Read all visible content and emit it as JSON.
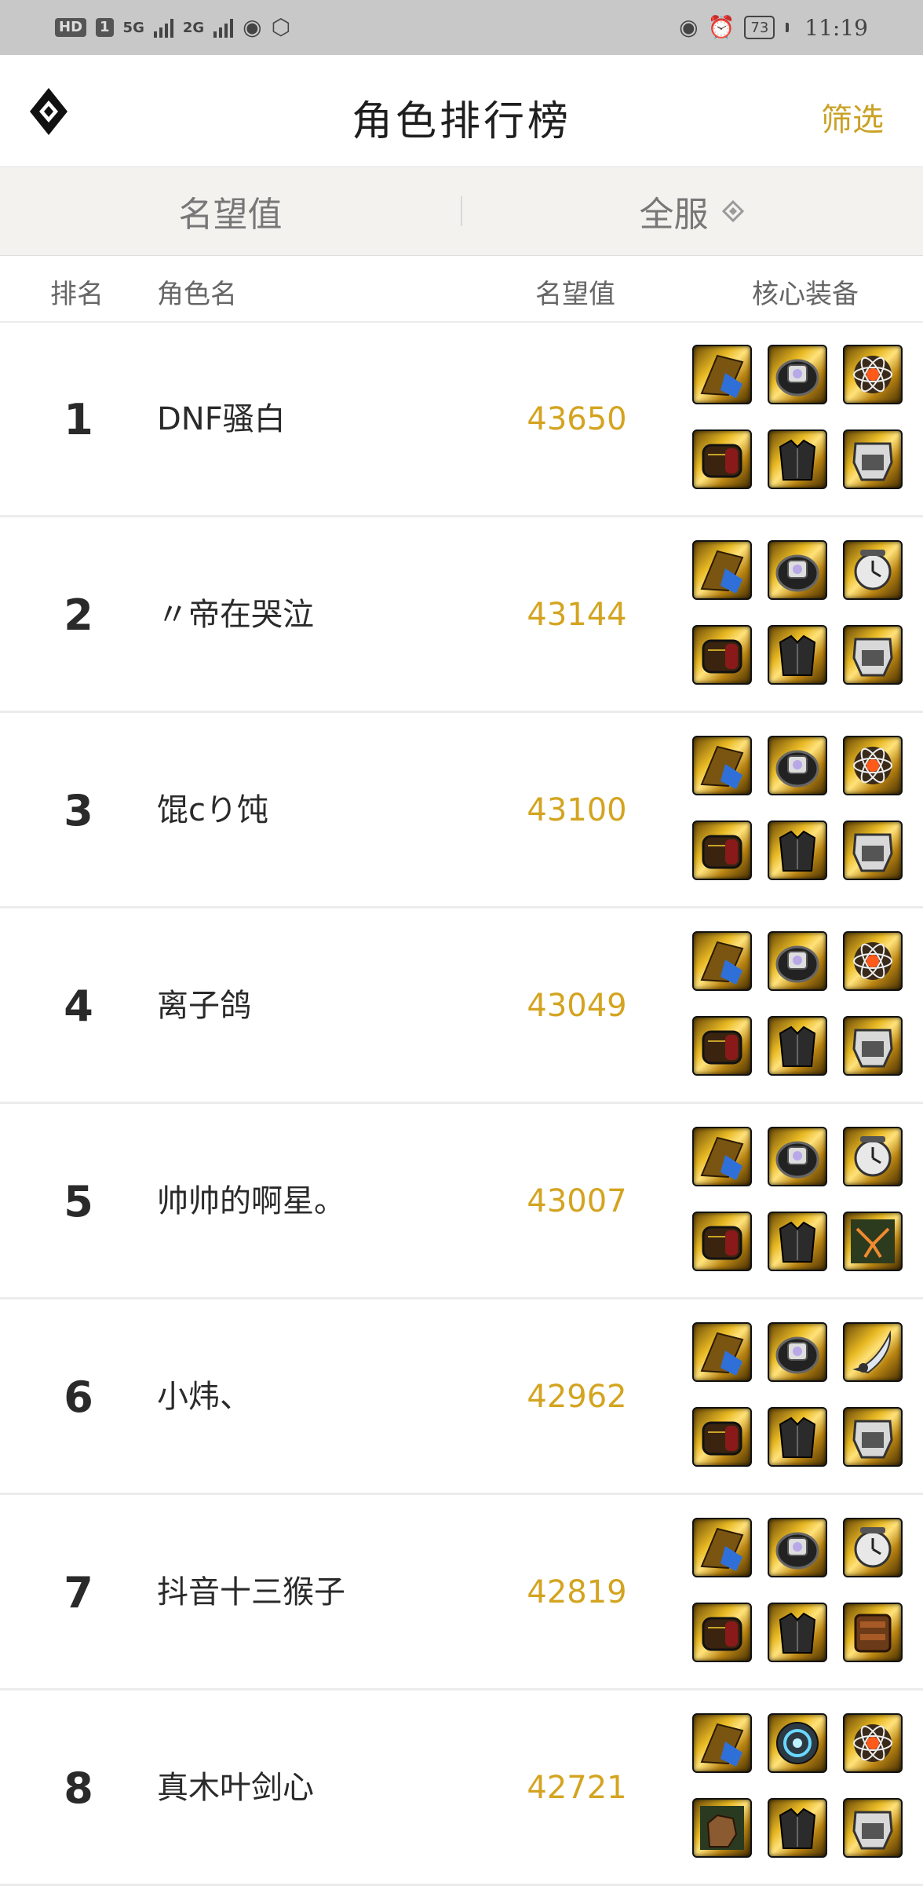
{
  "status_bar": {
    "hd": "HD",
    "sim": "1",
    "net1": "5G",
    "net2": "2G",
    "battery": "73",
    "time": "11:19",
    "icons": [
      "chat-bubble-icon",
      "hand-shield-icon",
      "eye-icon",
      "alarm-icon"
    ]
  },
  "header": {
    "title": "角色排行榜",
    "filter_label": "筛选",
    "logo_icon": "diamond-logo-icon"
  },
  "selector": {
    "left_label": "名望值",
    "right_label": "全服"
  },
  "columns": {
    "rank": "排名",
    "name": "角色名",
    "score": "名望值",
    "equip": "核心装备"
  },
  "colors": {
    "accent_gold": "#c9a227",
    "score_gold": "#d4a420"
  },
  "rows": [
    {
      "rank": "1",
      "name": "DNF骚白",
      "score": "43650",
      "equipment": [
        "shoulder",
        "bracelet",
        "atom-orb",
        "box",
        "dark-armor",
        "gauntlet-armor"
      ]
    },
    {
      "rank": "2",
      "name": "〃帝在哭泣",
      "score": "43144",
      "equipment": [
        "shoulder",
        "bracelet",
        "clock",
        "box",
        "dark-armor",
        "gauntlet-armor"
      ]
    },
    {
      "rank": "3",
      "name": "馄cり饨",
      "score": "43100",
      "equipment": [
        "shoulder",
        "bracelet",
        "atom-orb",
        "box",
        "dark-armor",
        "gauntlet-armor"
      ]
    },
    {
      "rank": "4",
      "name": "离子鸽",
      "score": "43049",
      "equipment": [
        "shoulder",
        "bracelet",
        "atom-orb",
        "box",
        "dark-armor",
        "gauntlet-armor"
      ]
    },
    {
      "rank": "5",
      "name": "帅帅的啊星。",
      "score": "43007",
      "equipment": [
        "shoulder",
        "bracelet",
        "clock",
        "box",
        "dark-armor",
        "green-scroll"
      ]
    },
    {
      "rank": "6",
      "name": "小炜、",
      "score": "42962",
      "equipment": [
        "shoulder",
        "bracelet",
        "blade",
        "box",
        "dark-armor",
        "gauntlet-armor"
      ]
    },
    {
      "rank": "7",
      "name": "抖音十三猴子",
      "score": "42819",
      "equipment": [
        "shoulder",
        "bracelet",
        "clock",
        "box",
        "dark-armor",
        "leather-pouch"
      ]
    },
    {
      "rank": "8",
      "name": "真木叶剑心",
      "score": "42721",
      "equipment": [
        "shoulder",
        "cyan-orb",
        "atom-orb",
        "leather-glove",
        "dark-armor",
        "gauntlet-armor"
      ]
    }
  ]
}
